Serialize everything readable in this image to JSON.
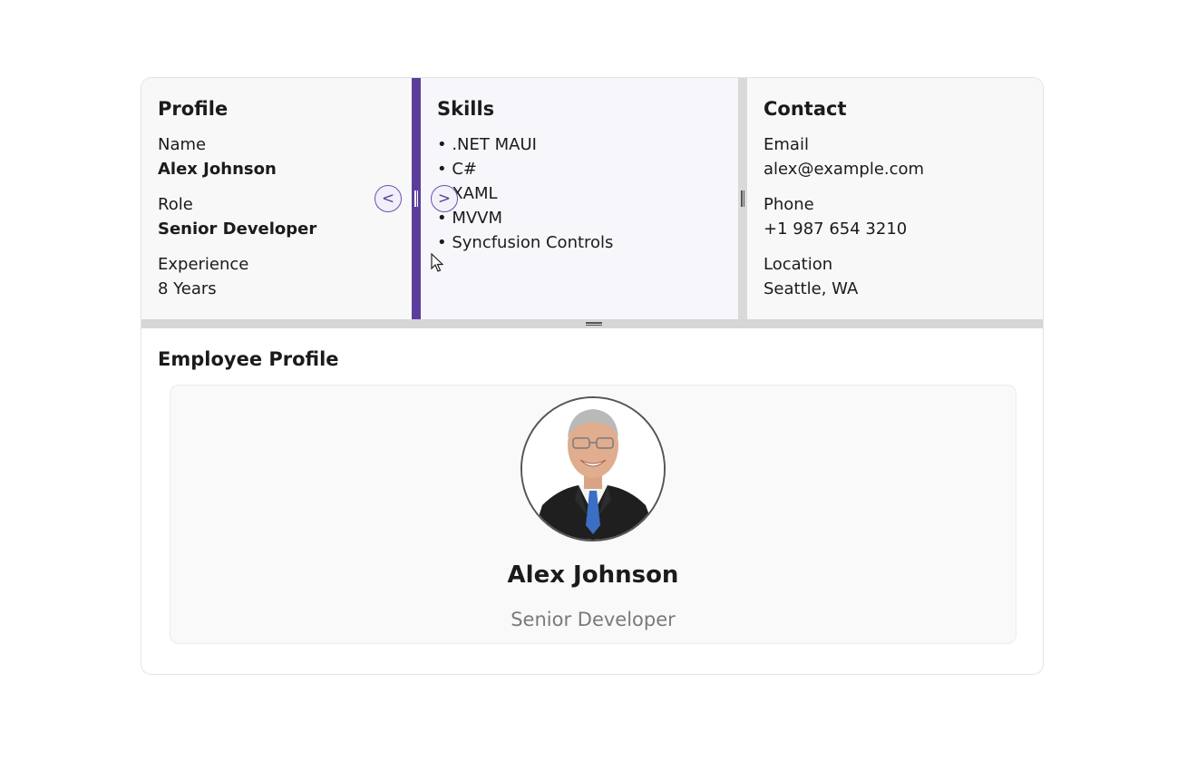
{
  "profile": {
    "title": "Profile",
    "name_label": "Name",
    "name_value": "Alex Johnson",
    "role_label": "Role",
    "role_value": "Senior Developer",
    "experience_label": "Experience",
    "experience_value": "8 Years"
  },
  "skills": {
    "title": "Skills",
    "items": [
      "• .NET MAUI",
      "• C#",
      "• XAML",
      "• MVVM",
      "• Syncfusion Controls"
    ]
  },
  "contact": {
    "title": "Contact",
    "email_label": "Email",
    "email_value": "alex@example.com",
    "phone_label": "Phone",
    "phone_value": "+1 987 654 3210",
    "location_label": "Location",
    "location_value": "Seattle, WA"
  },
  "splitter": {
    "collapse_left_icon": "chevron-left-icon",
    "expand_right_icon": "chevron-right-icon",
    "left_glyph": "<",
    "right_glyph": ">"
  },
  "employee_card": {
    "section_title": "Employee Profile",
    "name": "Alex Johnson",
    "role": "Senior Developer",
    "avatar_icon": "person-photo-icon"
  },
  "colors": {
    "accent": "#5b3e9b",
    "pane_bg": "#f8f8f9",
    "splitter_idle": "#d6d6d6",
    "muted_text": "#7a7a7a"
  }
}
